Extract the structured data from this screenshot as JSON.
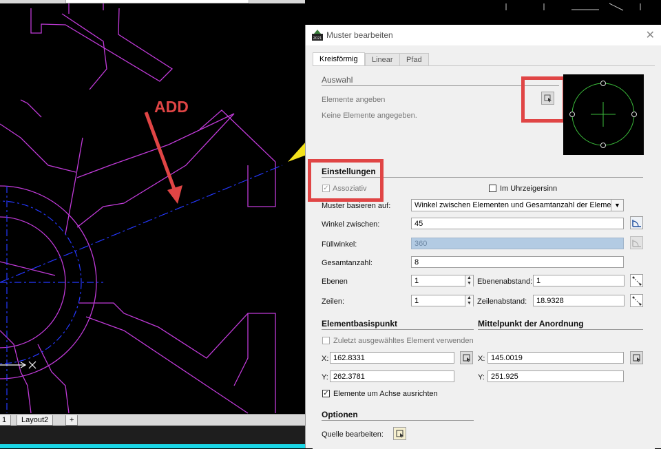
{
  "annotation": {
    "text": "ADD",
    "color": "#e04545"
  },
  "layout_tabs": [
    "1",
    "Layout2",
    "+"
  ],
  "dialog": {
    "title": "Muster bearbeiten",
    "icon_label": "2021",
    "tabs": [
      {
        "label": "Kreisförmig",
        "active": true
      },
      {
        "label": "Linear",
        "active": false
      },
      {
        "label": "Pfad",
        "active": false
      }
    ],
    "auswahl": {
      "header": "Auswahl",
      "elements_label": "Elemente angeben",
      "status": "Keine Elemente angegeben."
    },
    "einstellungen": {
      "header": "Einstellungen",
      "assoziativ_label": "Assoziativ",
      "clockwise_label": "Im Uhrzeigersinn",
      "muster_label": "Muster basieren auf:",
      "muster_value": "Winkel zwischen Elementen und Gesamtanzahl der Elemente",
      "winkel_label": "Winkel zwischen:",
      "winkel_value": "45",
      "fuell_label": "Füllwinkel:",
      "fuell_value": "360",
      "gesamt_label": "Gesamtanzahl:",
      "gesamt_value": "8",
      "ebenen_label": "Ebenen",
      "ebenen_value": "1",
      "ebenenabstand_label": "Ebenenabstand:",
      "ebenenabstand_value": "1",
      "zeilen_label": "Zeilen:",
      "zeilen_value": "1",
      "zeilenabstand_label": "Zeilenabstand:",
      "zeilenabstand_value": "18.9328"
    },
    "basispunkt": {
      "header": "Elementbasispunkt",
      "last_label": "Zuletzt ausgewähltes Element verwenden",
      "x_label": "X:",
      "x_value": "162.8331",
      "y_label": "Y:",
      "y_value": "262.3781",
      "align_label": "Elemente um Achse ausrichten"
    },
    "mittelpunkt": {
      "header": "Mittelpunkt der Anordnung",
      "x_label": "X:",
      "x_value": "145.0019",
      "y_label": "Y:",
      "y_value": "251.925"
    },
    "optionen": {
      "header": "Optionen",
      "quelle_label": "Quelle bearbeiten:"
    }
  }
}
